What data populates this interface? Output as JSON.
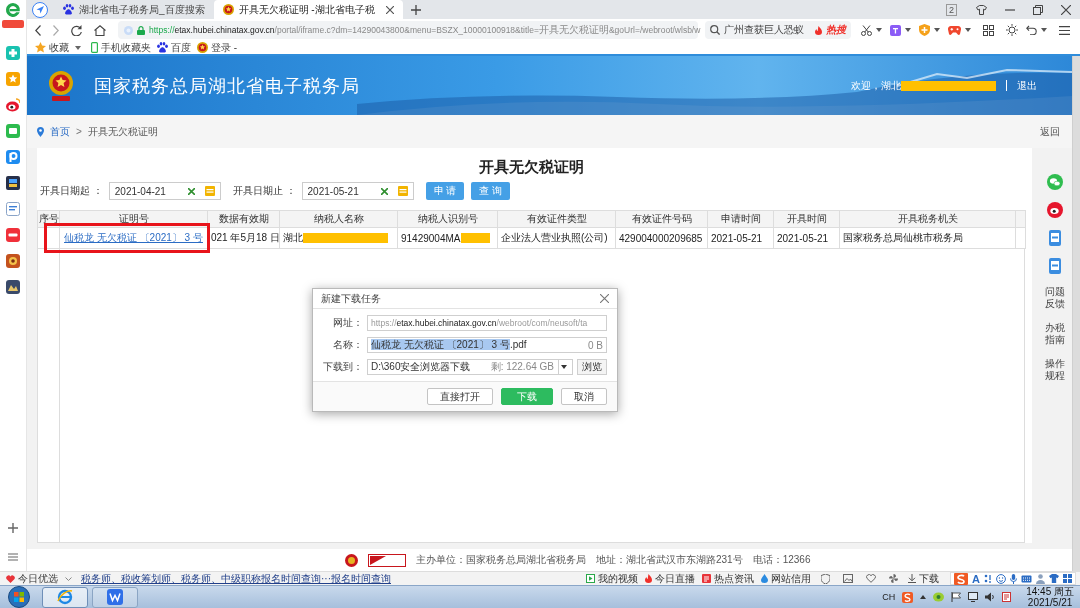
{
  "browser": {
    "tabs": [
      {
        "title": "湖北省电子税务局_百度搜索",
        "kind": "search",
        "selected": false
      },
      {
        "title": "开具无欠税证明 -湖北省电子税",
        "kind": "site",
        "selected": true
      }
    ],
    "window_count": "2",
    "address": {
      "scheme": "https://",
      "host": "etax.hubei.chinatax.gov.cn",
      "path": "/portal/iframe.c?dm=14290043800&menu=BSZX_10000100918&title=开具无欠税证明&goUrl=/webroot/wlsb/w"
    },
    "search": {
      "value": "广州查获巨人恐蚁",
      "badge": "热搜"
    },
    "bookmarks": [
      {
        "label": "收藏",
        "kind": "favorites"
      },
      {
        "label": "手机收藏夹",
        "kind": "mobile"
      },
      {
        "label": "百度",
        "kind": "search"
      },
      {
        "label": "登录 -",
        "kind": "site"
      }
    ]
  },
  "site": {
    "title": "国家税务总局湖北省电子税务局",
    "welcome": "欢迎，湖北",
    "welcome_redacted": true,
    "logout": "退出"
  },
  "breadcrumb": {
    "items": [
      {
        "label": "首页",
        "link": true
      },
      {
        "label": "开具无欠税证明",
        "link": false
      }
    ],
    "separator": ">",
    "back": "返回"
  },
  "form": {
    "title": "开具无欠税证明",
    "filters": [
      {
        "label": "开具日期起 ：",
        "value": "2021-04-21"
      },
      {
        "label": "开具日期止 ：",
        "value": "2021-05-21"
      }
    ],
    "buttons": [
      "申 请",
      "查 询"
    ]
  },
  "table": {
    "columns": [
      "序号",
      "证明号",
      "数据有效期",
      "纳税人名称",
      "纳税人识别号",
      "有效证件类型",
      "有效证件号码",
      "申请时间",
      "开具时间",
      "开具税务机关"
    ],
    "rows": [
      {
        "cells": [
          {
            "kind": "empty"
          },
          {
            "kind": "link",
            "text": "仙税龙 无欠税证 〔2021〕 3 号",
            "boxed": true
          },
          {
            "kind": "text",
            "text": "021 年5月18 日"
          },
          {
            "kind": "redacted",
            "text": "湖北"
          },
          {
            "kind": "redacted",
            "text": "91429004MA"
          },
          {
            "kind": "text",
            "text": "企业法人营业执照(公司)"
          },
          {
            "kind": "text",
            "text": "429004000209685"
          },
          {
            "kind": "text",
            "text": "2021-05-21"
          },
          {
            "kind": "text",
            "text": "2021-05-21"
          },
          {
            "kind": "text",
            "text": "国家税务总局仙桃市税务局"
          }
        ]
      }
    ]
  },
  "side_panel": {
    "links": [
      "问题反馈",
      "办税指南",
      "操作规程"
    ]
  },
  "dialog": {
    "title": "新建下载任务",
    "fields": [
      {
        "kind": "url",
        "label": "网址：",
        "scheme": "https://",
        "host": "etax.hubei.chinatax.gov.cn",
        "path": "/webroot/com/neusoft/ta"
      },
      {
        "kind": "name",
        "label": "名称：",
        "value": "仙税龙 无欠税证 〔2021〕 3 号",
        "extension": ".pdf",
        "value_selected": true,
        "size": "0 B"
      },
      {
        "kind": "folder",
        "label": "下载到：",
        "value": "D:\\360安全浏览器下载",
        "free": "剩: 122.64 GB",
        "browse": "浏览"
      }
    ],
    "buttons": [
      {
        "label": "直接打开",
        "primary": false
      },
      {
        "label": "下载",
        "primary": true
      },
      {
        "label": "取消",
        "primary": false
      }
    ]
  },
  "footer": {
    "text": "主办单位：国家税务总局湖北省税务局　地址：湖北省武汉市东湖路231号　电话：12366"
  },
  "status_bar": {
    "promo": "今日优选",
    "news": "税务师、税收筹划师、税务师、中级职称报名时间查询···报名时间查询",
    "links": [
      {
        "label": "我的视频",
        "kind": "video"
      },
      {
        "label": "今日直播",
        "kind": "live"
      },
      {
        "label": "热点资讯",
        "kind": "news"
      },
      {
        "label": "网站信用",
        "kind": "credit"
      }
    ],
    "download": "下载",
    "input_mode": "A"
  },
  "taskbar": {
    "language": "CH",
    "time": "14:45 周五",
    "date": "2021/5/21"
  }
}
